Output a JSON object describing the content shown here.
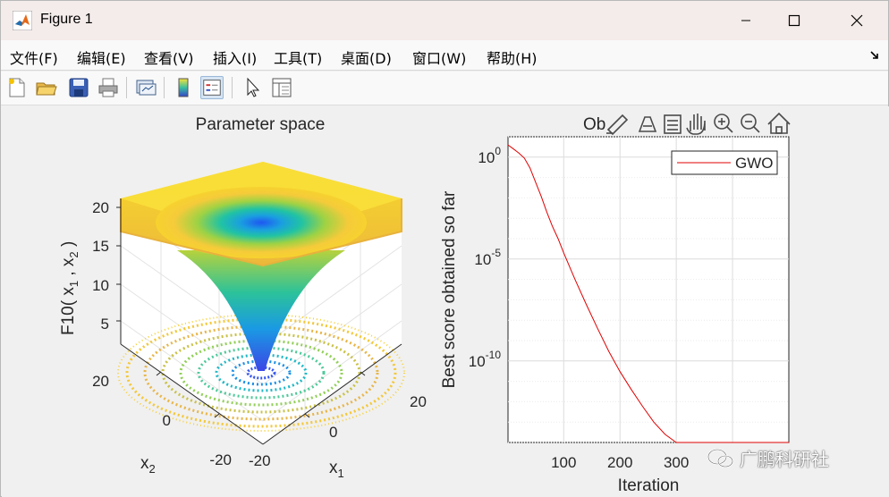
{
  "window": {
    "title": "Figure 1",
    "minimize_label": "—",
    "maximize_label": "☐",
    "close_label": "✕"
  },
  "menu": {
    "items": [
      "文件(F)",
      "编辑(E)",
      "查看(V)",
      "插入(I)",
      "工具(T)",
      "桌面(D)",
      "窗口(W)",
      "帮助(H)"
    ]
  },
  "toolbar": {
    "icons": [
      "new-figure-icon",
      "open-icon",
      "save-icon",
      "print-icon",
      "link-plot-icon",
      "colorbar-icon",
      "legend-icon",
      "edit-plot-arrow-icon",
      "property-inspector-icon"
    ]
  },
  "axes_toolbar": {
    "icons": [
      "brush-icon",
      "data-tips-icon",
      "rotate-icon",
      "pan-icon",
      "zoom-in-icon",
      "zoom-out-icon",
      "home-icon"
    ]
  },
  "chart_data": [
    {
      "type": "surface",
      "title": "Parameter space",
      "xlabel": "x1",
      "ylabel": "x2",
      "zlabel": "F10( x1 , x2 )",
      "x_ticks": [
        "-20",
        "0",
        "20"
      ],
      "y_ticks": [
        "-20",
        "0",
        "20"
      ],
      "z_ticks": [
        "5",
        "10",
        "15",
        "20"
      ],
      "xlim": [
        -32,
        32
      ],
      "ylim": [
        -32,
        32
      ],
      "zlim": [
        0,
        22
      ],
      "colormap": "parula",
      "contour_floor": true,
      "grid": true
    },
    {
      "type": "line",
      "title": "Ob",
      "xlabel": "Iteration",
      "ylabel": "Best score obtained so far",
      "yscale": "log",
      "x_ticks": [
        "100",
        "200",
        "300"
      ],
      "y_ticks": [
        "10^0",
        "10^-5",
        "10^-10"
      ],
      "xlim": [
        1,
        500
      ],
      "ylim": [
        1e-14,
        10
      ],
      "grid": true,
      "legend_position": "top-right",
      "series": [
        {
          "name": "GWO",
          "color": "#e00000",
          "x": [
            1,
            10,
            20,
            30,
            40,
            50,
            60,
            70,
            80,
            90,
            100,
            120,
            140,
            160,
            180,
            200,
            220,
            240,
            260,
            280,
            300,
            320,
            340,
            360,
            380,
            400,
            420,
            440,
            460,
            480,
            500
          ],
          "y": [
            4,
            2.6,
            1.6,
            0.9,
            0.3,
            0.06,
            0.012,
            0.002,
            0.0004,
            0.0001,
            2e-05,
            1e-06,
            6e-08,
            4e-09,
            3e-10,
            3e-11,
            4e-12,
            6e-13,
            1e-13,
            2.5e-14,
            8e-15,
            3e-15,
            1.5e-15,
            9e-16,
            8.9e-16,
            8.9e-16,
            8.9e-16,
            8.9e-16,
            8.9e-16,
            8.9e-16,
            8.9e-16
          ]
        }
      ]
    }
  ],
  "watermark": {
    "text": "广鹏科研社"
  }
}
